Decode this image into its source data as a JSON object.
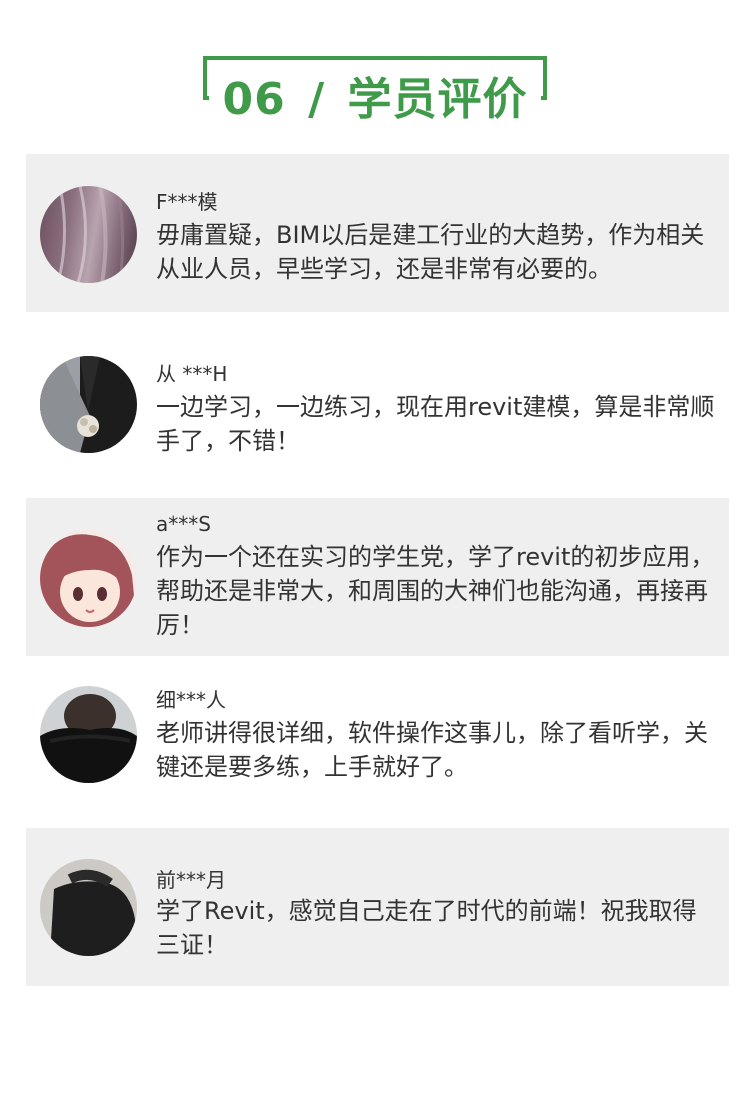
{
  "header": {
    "number": "06",
    "separator": "/",
    "title": "学员评价"
  },
  "reviews": [
    {
      "user": "F***模",
      "text": "毋庸置疑，BIM以后是建工行业的大趋势，作为相关从业人员，早些学习，还是非常有必要的。",
      "avatar": "gray-hair-avatar-icon"
    },
    {
      "user": "从 ***H",
      "text": "一边学习，一边练习，现在用revit建模，算是非常顺手了，不错！",
      "avatar": "suit-brooch-avatar-icon"
    },
    {
      "user": "a***S",
      "text": "作为一个还在实习的学生党，学了revit的初步应用，帮助还是非常大，和周围的大神们也能沟通，再接再厉！",
      "avatar": "anime-girl-avatar-icon"
    },
    {
      "user": "细***人",
      "text": "老师讲得很详细，软件操作这事儿，除了看听学，关键还是要多练，上手就好了。",
      "avatar": "dark-collar-avatar-icon"
    },
    {
      "user": "前***月",
      "text": "学了Revit，感觉自己走在了时代的前端！祝我取得三证！",
      "avatar": "dark-shirt-avatar-icon"
    }
  ],
  "colors": {
    "accent": "#3f9a4a",
    "card_bg": "#efefef",
    "text": "#333333"
  }
}
